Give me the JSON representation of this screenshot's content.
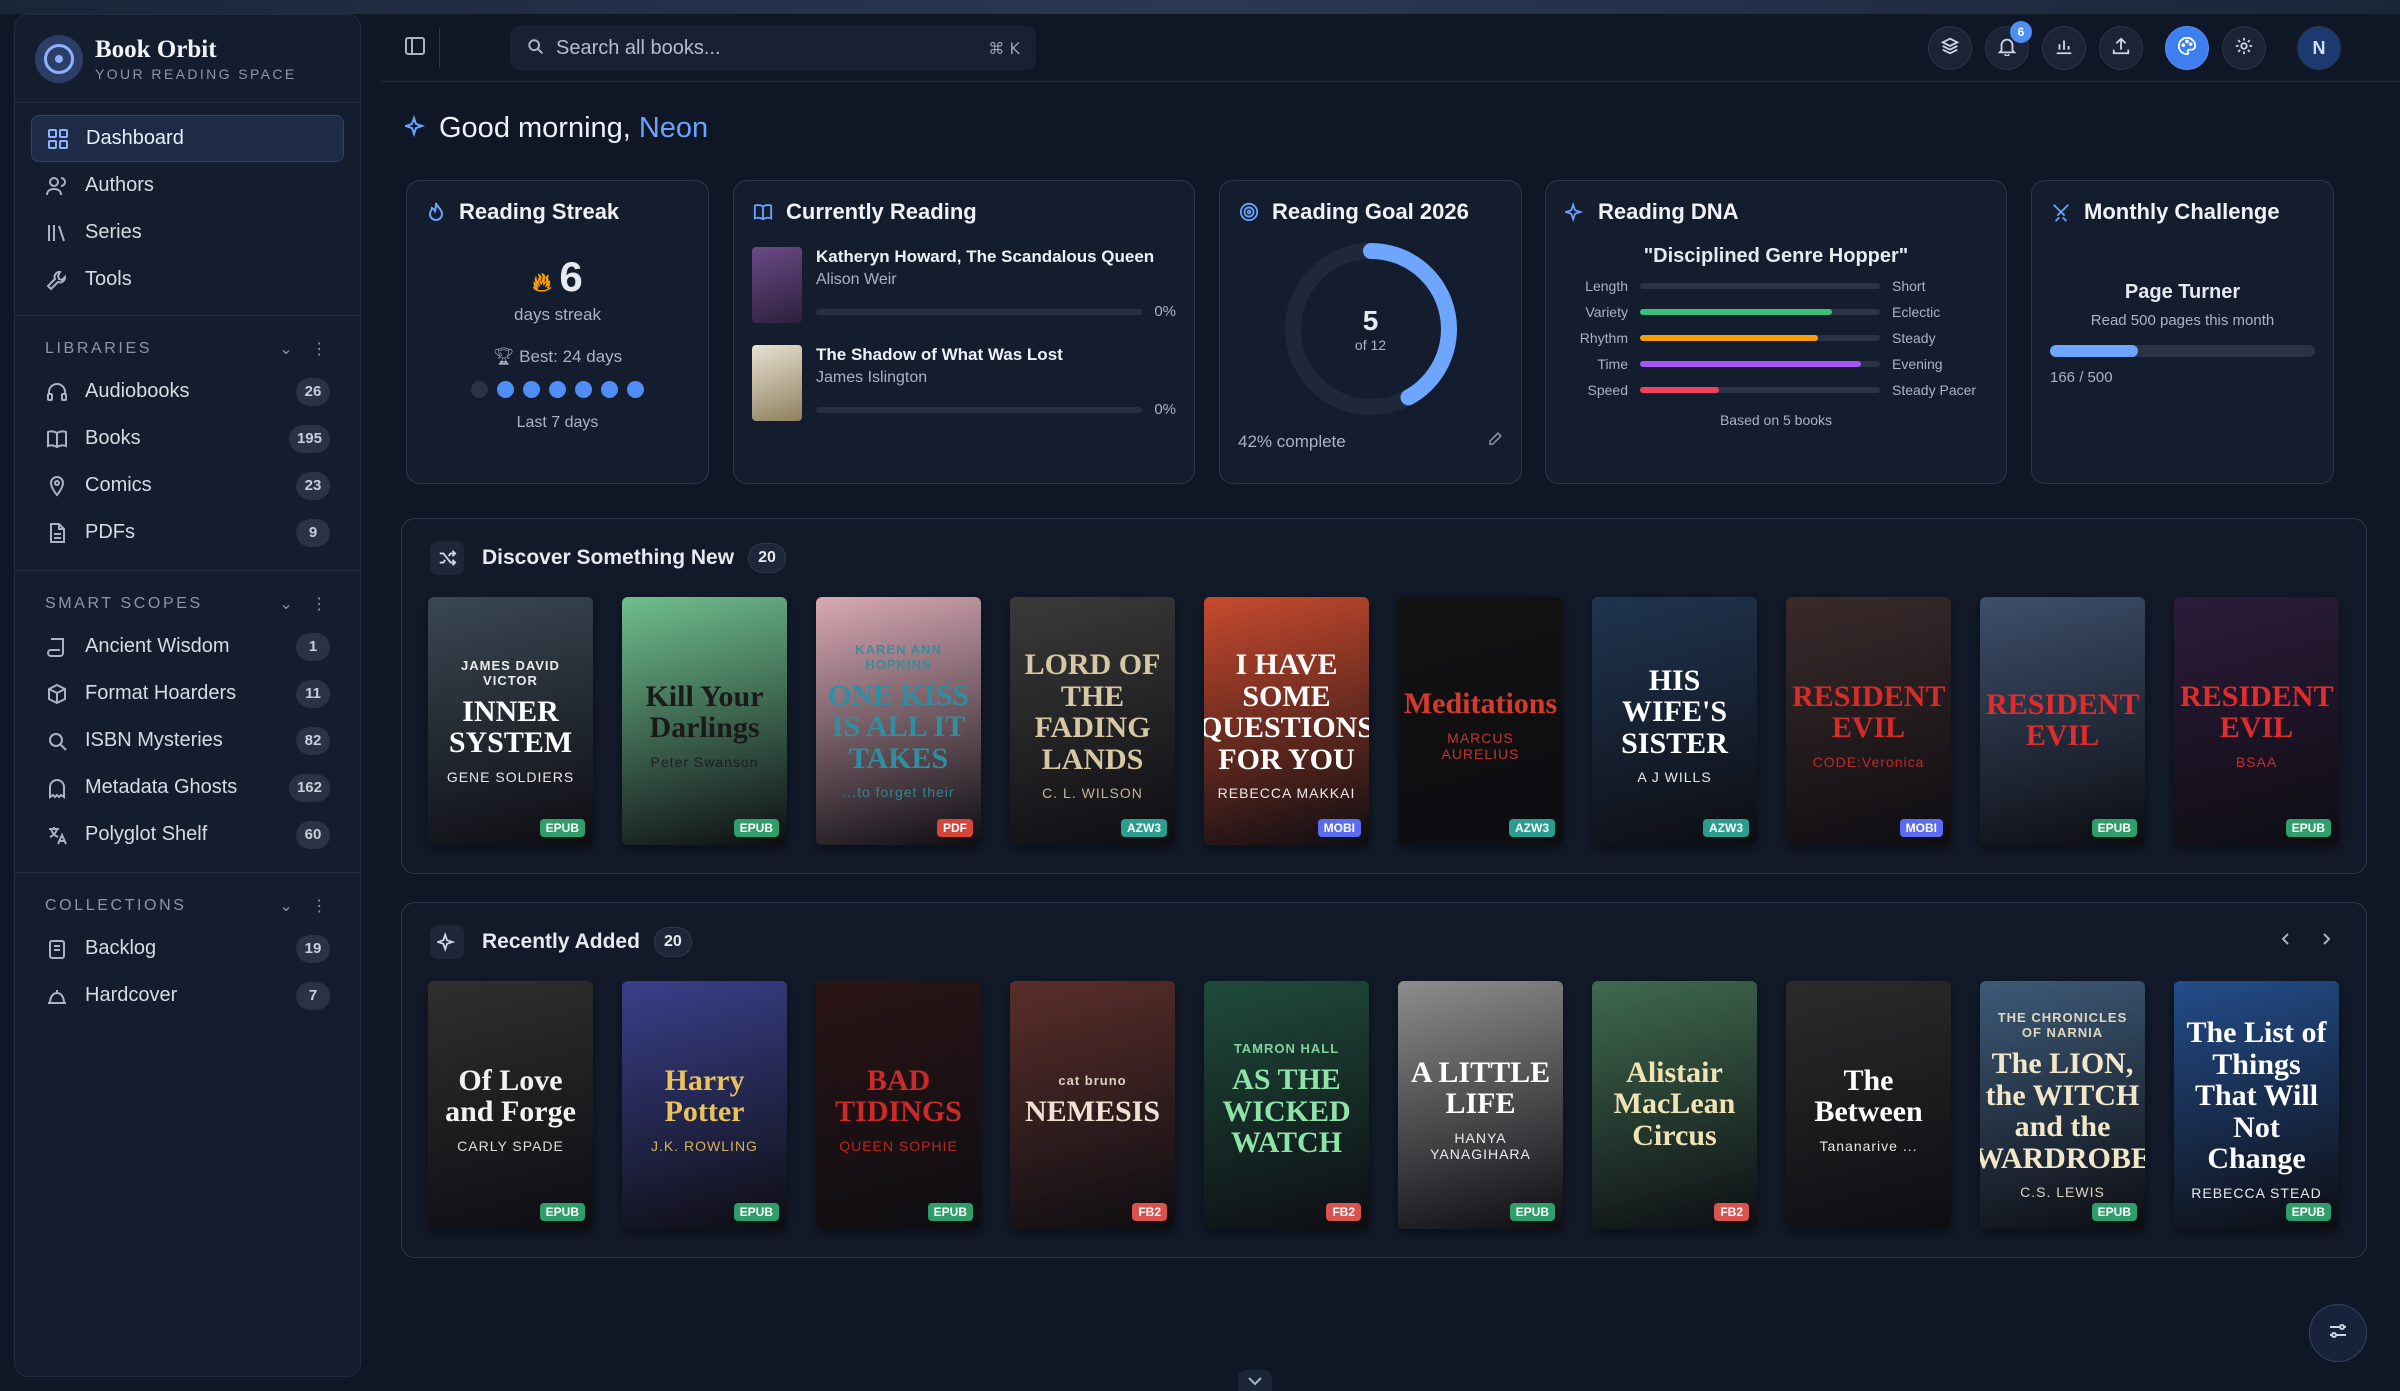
{
  "brand": {
    "name": "Book Orbit",
    "tagline": "YOUR READING SPACE"
  },
  "nav": [
    {
      "label": "Dashboard",
      "icon": "grid-icon",
      "active": true
    },
    {
      "label": "Authors",
      "icon": "users-icon"
    },
    {
      "label": "Series",
      "icon": "library-icon"
    },
    {
      "label": "Tools",
      "icon": "wrench-icon"
    }
  ],
  "libraries": {
    "title": "LIBRARIES",
    "items": [
      {
        "label": "Audiobooks",
        "count": "26",
        "icon": "headphones-icon"
      },
      {
        "label": "Books",
        "count": "195",
        "icon": "book-open-icon"
      },
      {
        "label": "Comics",
        "count": "23",
        "icon": "pin-icon"
      },
      {
        "label": "PDFs",
        "count": "9",
        "icon": "file-icon"
      }
    ]
  },
  "smart_scopes": {
    "title": "SMART SCOPES",
    "items": [
      {
        "label": "Ancient Wisdom",
        "count": "1",
        "icon": "scroll-icon"
      },
      {
        "label": "Format Hoarders",
        "count": "11",
        "icon": "package-icon"
      },
      {
        "label": "ISBN Mysteries",
        "count": "82",
        "icon": "search-icon"
      },
      {
        "label": "Metadata Ghosts",
        "count": "162",
        "icon": "ghost-icon"
      },
      {
        "label": "Polyglot Shelf",
        "count": "60",
        "icon": "translate-icon"
      }
    ]
  },
  "collections": {
    "title": "COLLECTIONS",
    "items": [
      {
        "label": "Backlog",
        "count": "19",
        "icon": "archive-icon"
      },
      {
        "label": "Hardcover",
        "count": "7",
        "icon": "bell-icon"
      }
    ]
  },
  "search": {
    "placeholder": "Search all books...",
    "shortcut": "⌘ K"
  },
  "topbar": {
    "notifications": "6",
    "avatar": "N"
  },
  "greeting": {
    "text": "Good morning,",
    "name": "Neon"
  },
  "streak": {
    "title": "Reading Streak",
    "days": "6",
    "label": "days streak",
    "best": "Best: 24 days",
    "footer": "Last 7 days",
    "week": [
      false,
      true,
      true,
      true,
      true,
      true,
      true
    ]
  },
  "currently_reading": {
    "title": "Currently Reading",
    "items": [
      {
        "title": "Katheryn Howard, The Scandalous Queen",
        "author": "Alison Weir",
        "percent": "0%"
      },
      {
        "title": "The Shadow of What Was Lost",
        "author": "James Islington",
        "percent": "0%"
      }
    ]
  },
  "goal": {
    "title": "Reading Goal 2026",
    "current": "5",
    "of": "of 12",
    "footer": "42% complete",
    "progress": 0.42
  },
  "dna": {
    "title": "Reading DNA",
    "persona": "\"Disciplined Genre Hopper\"",
    "rows": [
      {
        "left": "Length",
        "right": "Short",
        "value": 0,
        "color": "#4f8df7"
      },
      {
        "left": "Variety",
        "right": "Eclectic",
        "value": 0.8,
        "color": "#3bbf7a"
      },
      {
        "left": "Rhythm",
        "right": "Steady",
        "value": 0.74,
        "color": "#f59e0b"
      },
      {
        "left": "Time",
        "right": "Evening",
        "value": 0.92,
        "color": "#a855f7"
      },
      {
        "left": "Speed",
        "right": "Steady Pacer",
        "value": 0.33,
        "color": "#f43f5e"
      }
    ],
    "footer": "Based on 5 books"
  },
  "challenge": {
    "title": "Monthly Challenge",
    "name": "Page Turner",
    "desc": "Read 500 pages this month",
    "count": "166 / 500",
    "progress": 0.332
  },
  "discover": {
    "title": "Discover Something New",
    "count": "20",
    "books": [
      {
        "top": "JAMES DAVID VICTOR",
        "title": "INNER SYSTEM",
        "author": "GENE SOLDIERS",
        "format": "EPUB",
        "bg": "#3a4752",
        "fg": "#ffffff"
      },
      {
        "top": "",
        "title": "Kill Your Darlings",
        "author": "Peter Swanson",
        "format": "EPUB",
        "bg": "#6fbf8d",
        "fg": "#1a1a1a"
      },
      {
        "top": "KAREN ANN HOPKINS",
        "title": "ONE KISS IS ALL IT TAKES",
        "author": "...to forget their",
        "format": "PDF",
        "bg": "#d9a9b4",
        "fg": "#2f8ea0"
      },
      {
        "top": "",
        "title": "LORD OF THE FADING LANDS",
        "author": "C. L. WILSON",
        "format": "AZW3",
        "bg": "#3b3a39",
        "fg": "#d8c7a3"
      },
      {
        "top": "",
        "title": "I HAVE SOME QUESTIONS FOR YOU",
        "author": "REBECCA MAKKAI",
        "format": "MOBI",
        "bg": "#c84a2e",
        "fg": "#ffffff"
      },
      {
        "top": "",
        "title": "Meditations",
        "author": "MARCUS AURELIUS",
        "format": "AZW3",
        "bg": "#121212",
        "fg": "#d33b2f"
      },
      {
        "top": "",
        "title": "HIS WIFE'S SISTER",
        "author": "A J WILLS",
        "format": "AZW3",
        "bg": "#1f3450",
        "fg": "#ffffff"
      },
      {
        "top": "",
        "title": "RESIDENT EVIL",
        "author": "CODE:Veronica",
        "format": "MOBI",
        "bg": "#3a2a2a",
        "fg": "#d42b2b"
      },
      {
        "top": "",
        "title": "RESIDENT EVIL",
        "author": "",
        "format": "EPUB",
        "bg": "#3c4f6b",
        "fg": "#e02c2c"
      },
      {
        "top": "",
        "title": "RESIDENT EVIL",
        "author": "BSAA",
        "format": "EPUB",
        "bg": "#2c1b3a",
        "fg": "#e02c2c"
      }
    ]
  },
  "recent": {
    "title": "Recently Added",
    "count": "20",
    "books": [
      {
        "top": "",
        "title": "Of Love and Forge",
        "author": "CARLY SPADE",
        "format": "EPUB",
        "bg": "#2f2f2f",
        "fg": "#f2f2f2"
      },
      {
        "top": "",
        "title": "Harry Potter",
        "author": "J.K. ROWLING",
        "format": "EPUB",
        "bg": "#3a3f8a",
        "fg": "#e8c35b"
      },
      {
        "top": "",
        "title": "BAD TIDINGS",
        "author": "QUEEN SOPHIE",
        "format": "EPUB",
        "bg": "#2a1414",
        "fg": "#c92a2a"
      },
      {
        "top": "cat bruno",
        "title": "NEMESIS",
        "author": "",
        "format": "FB2",
        "bg": "#5a2e2a",
        "fg": "#efe1d4"
      },
      {
        "top": "TAMRON HALL",
        "title": "AS THE WICKED WATCH",
        "author": "",
        "format": "FB2",
        "bg": "#1f4b3b",
        "fg": "#8de3a8"
      },
      {
        "top": "",
        "title": "A LITTLE LIFE",
        "author": "HANYA YANAGIHARA",
        "format": "EPUB",
        "bg": "#8d8d8d",
        "fg": "#ffffff"
      },
      {
        "top": "",
        "title": "Alistair MacLean Circus",
        "author": "",
        "format": "FB2",
        "bg": "#3f6a4f",
        "fg": "#f1e4b4"
      },
      {
        "top": "",
        "title": "The Between",
        "author": "Tananarive ...",
        "format": "",
        "bg": "#2b2b2b",
        "fg": "#ffffff"
      },
      {
        "top": "THE CHRONICLES OF NARNIA",
        "title": "The LION, the WITCH and the WARDROBE",
        "author": "C.S. LEWIS",
        "format": "EPUB",
        "bg": "#3d5a78",
        "fg": "#f2e7c8"
      },
      {
        "top": "",
        "title": "The List of Things That Will Not Change",
        "author": "REBECCA STEAD",
        "format": "EPUB",
        "bg": "#234d8a",
        "fg": "#ffffff"
      }
    ]
  }
}
